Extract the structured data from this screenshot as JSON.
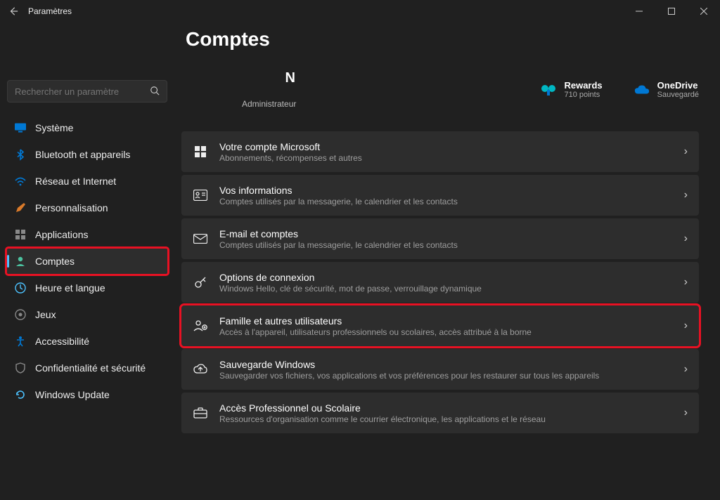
{
  "window": {
    "title": "Paramètres"
  },
  "search": {
    "placeholder": "Rechercher un paramètre"
  },
  "sidebar": {
    "items": [
      {
        "label": "Système"
      },
      {
        "label": "Bluetooth et appareils"
      },
      {
        "label": "Réseau et Internet"
      },
      {
        "label": "Personnalisation"
      },
      {
        "label": "Applications"
      },
      {
        "label": "Comptes"
      },
      {
        "label": "Heure et langue"
      },
      {
        "label": "Jeux"
      },
      {
        "label": "Accessibilité"
      },
      {
        "label": "Confidentialité et sécurité"
      },
      {
        "label": "Windows Update"
      }
    ]
  },
  "page": {
    "title": "Comptes"
  },
  "account": {
    "name": "N",
    "role": "Administrateur",
    "rewards": {
      "label": "Rewards",
      "value": "710 points"
    },
    "onedrive": {
      "label": "OneDrive",
      "value": "Sauvegardé"
    }
  },
  "rows": [
    {
      "title": "Votre compte Microsoft",
      "sub": "Abonnements, récompenses et autres"
    },
    {
      "title": "Vos informations",
      "sub": "Comptes utilisés par la messagerie, le calendrier et les contacts"
    },
    {
      "title": "E-mail et comptes",
      "sub": "Comptes utilisés par la messagerie, le calendrier et les contacts"
    },
    {
      "title": "Options de connexion",
      "sub": "Windows Hello, clé de sécurité, mot de passe, verrouillage dynamique"
    },
    {
      "title": "Famille et autres utilisateurs",
      "sub": "Accès à l'appareil, utilisateurs professionnels ou scolaires, accès attribué à la borne"
    },
    {
      "title": "Sauvegarde Windows",
      "sub": "Sauvegarder vos fichiers, vos applications et vos préférences pour les restaurer sur tous les appareils"
    },
    {
      "title": "Accès Professionnel ou Scolaire",
      "sub": "Ressources d'organisation comme le courrier électronique, les applications et le réseau"
    }
  ]
}
